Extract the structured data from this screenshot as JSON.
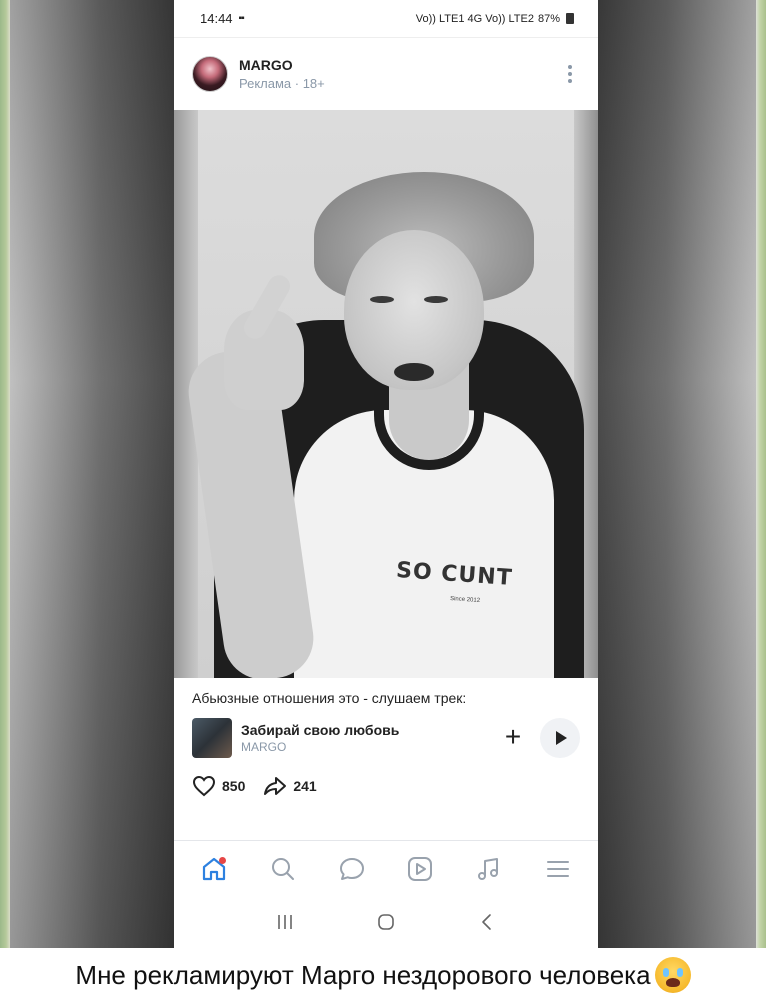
{
  "statusbar": {
    "time": "14:44",
    "time_icon": "grid-icon",
    "signal_text": "Vo)) LTE1 4G Vo)) LTE2",
    "battery": "87%"
  },
  "post": {
    "author_name": "MARGO",
    "author_meta": "Реклама · 18+",
    "shirt_print": "SO CUNT",
    "shirt_subprint": "Since 2012",
    "caption": "Абьюзные отношения это - слушаем трек:",
    "track": {
      "title": "Забирай свою любовь",
      "artist": "MARGO"
    },
    "likes": "850",
    "shares": "241"
  },
  "tabbar": {
    "items": [
      "home-icon",
      "search-icon",
      "messages-icon",
      "video-icon",
      "music-icon",
      "menu-icon"
    ],
    "active": "home-icon",
    "accent": "#2d81e0",
    "badge_color": "#e64646"
  },
  "navbar": {
    "items": [
      "recent-apps",
      "home",
      "back"
    ]
  },
  "bottom_caption": "Мне рекламируют Марго нездорового человека"
}
